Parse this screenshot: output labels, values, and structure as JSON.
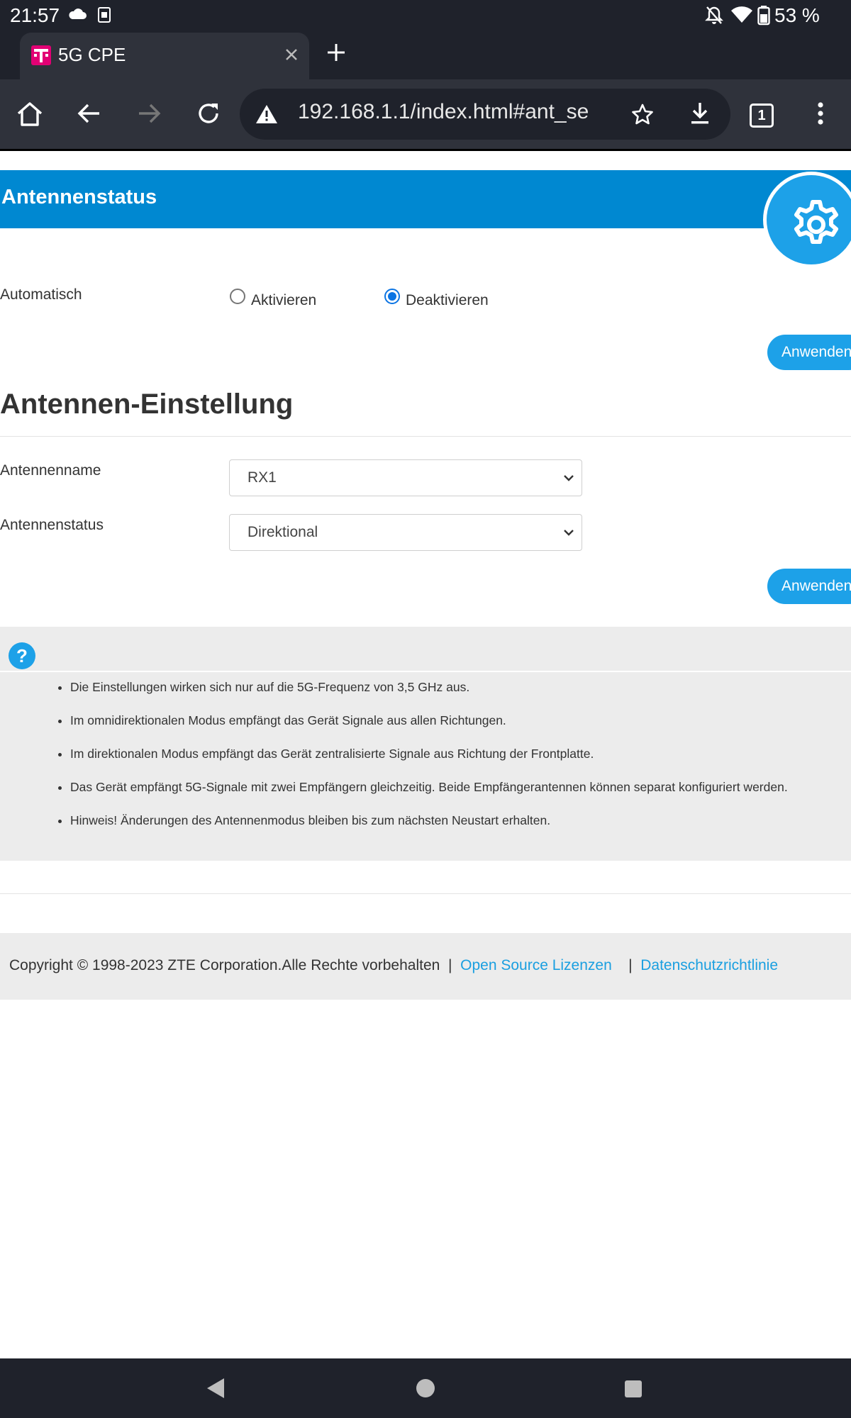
{
  "status_bar": {
    "time": "21:57",
    "battery": "53 %"
  },
  "browser": {
    "tab_title": "5G CPE",
    "url": "192.168.1.1/index.html#ant_se",
    "tab_count": "1"
  },
  "antenna_status": {
    "title": "Antennenstatus",
    "auto_label": "Automatisch",
    "option_activate": "Aktivieren",
    "option_deactivate": "Deaktivieren",
    "selected": "Deaktivieren",
    "apply_label": "Anwenden"
  },
  "antenna_settings": {
    "title": "Antennen-Einstellung",
    "name_label": "Antennenname",
    "name_value": "RX1",
    "status_label": "Antennenstatus",
    "status_value": "Direktional",
    "apply_label": "Anwenden"
  },
  "help": {
    "icon": "?",
    "items": [
      "Die Einstellungen wirken sich nur auf die 5G-Frequenz von 3,5 GHz aus.",
      "Im omnidirektionalen Modus empfängt das Gerät Signale aus allen Richtungen.",
      "Im direktionalen Modus empfängt das Gerät zentralisierte Signale aus Richtung der Frontplatte.",
      "Das Gerät empfängt 5G-Signale mit zwei Empfängern gleichzeitig. Beide Empfängerantennen können separat konfiguriert werden.",
      "Hinweis! Änderungen des Antennenmodus bleiben bis zum nächsten Neustart erhalten."
    ]
  },
  "footer": {
    "copyright": "Copyright © 1998-2023 ZTE Corporation.Alle Rechte vorbehalten",
    "separator": "|",
    "link_licenses": "Open Source Lizenzen",
    "link_privacy": "Datenschutzrichtlinie"
  },
  "colors": {
    "banner": "#0088d1",
    "accent": "#1da1e8",
    "link": "#1a9fe0",
    "brand_magenta": "#e20074",
    "chrome_dark": "#1f222b"
  }
}
